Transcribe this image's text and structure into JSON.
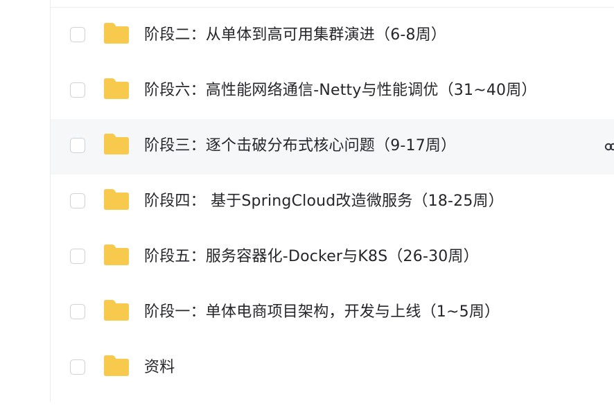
{
  "file_list": {
    "items": [
      {
        "name": "阶段二：从单体到高可用集群演进（6-8周）",
        "hovered": false
      },
      {
        "name": "阶段六：高性能网络通信-Netty与性能调优（31~40周）",
        "hovered": false
      },
      {
        "name": "阶段三：逐个击破分布式核心问题（9-17周）",
        "hovered": true
      },
      {
        "name": "阶段四： 基于SpringCloud改造微服务（18-25周）",
        "hovered": false
      },
      {
        "name": "阶段五：服务容器化-Docker与K8S（26-30周）",
        "hovered": false
      },
      {
        "name": "阶段一：单体电商项目架构，开发与上线（1~5周）",
        "hovered": false
      },
      {
        "name": "资料",
        "hovered": false
      }
    ]
  },
  "colors": {
    "folder": "#f7c94d",
    "hover_row": "#f6f7f9",
    "text": "#25262b",
    "checkbox_border": "#cdd1d8"
  },
  "icons": {
    "folder": "folder-icon",
    "share": "link-icon"
  }
}
